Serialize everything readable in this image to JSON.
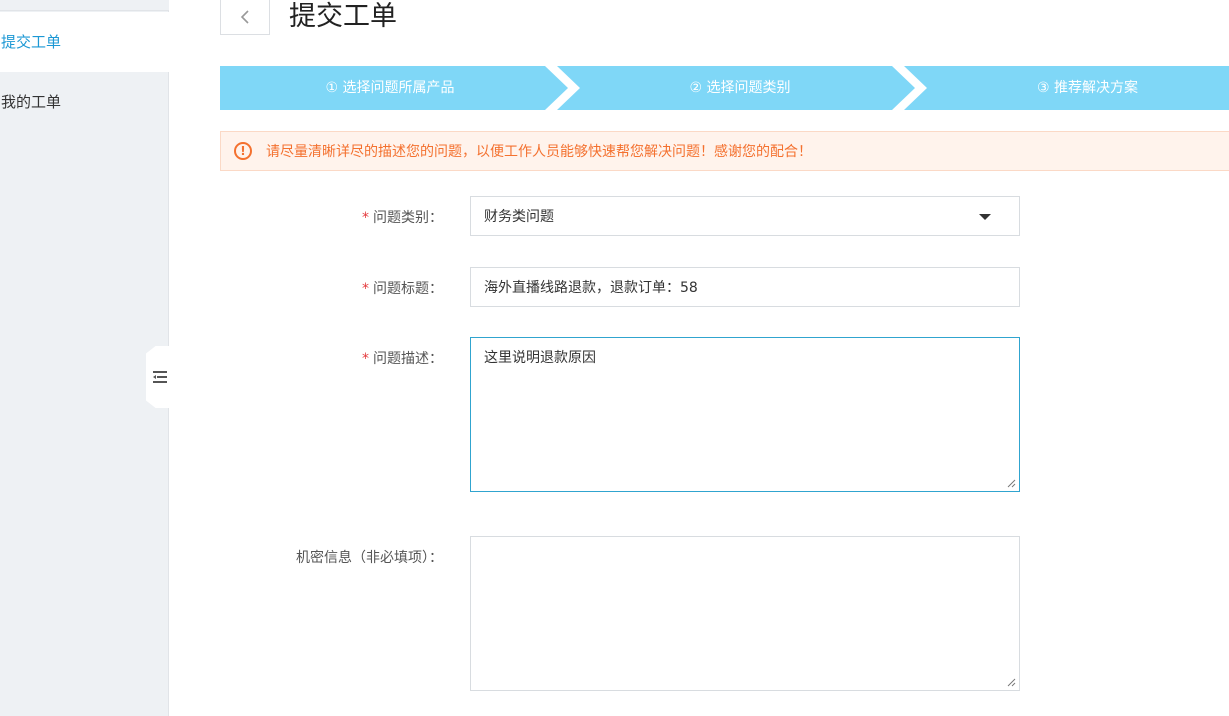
{
  "sidebar": {
    "items": [
      {
        "label": "提交工单",
        "active": true
      },
      {
        "label": "我的工单",
        "active": false
      }
    ]
  },
  "header": {
    "title": "提交工单"
  },
  "steps": [
    {
      "label": "① 选择问题所属产品"
    },
    {
      "label": "② 选择问题类别"
    },
    {
      "label": "③ 推荐解决方案"
    }
  ],
  "alert": {
    "icon": "exclamation-circle-icon",
    "text": "请尽量清晰详尽的描述您的问题，以便工作人员能够快速帮您解决问题！感谢您的配合！"
  },
  "form": {
    "category": {
      "label": "问题类别：",
      "value": "财务类问题"
    },
    "title": {
      "label": "问题标题：",
      "value": "海外直播线路退款，退款订单：58"
    },
    "description": {
      "label": "问题描述：",
      "value": "这里说明退款原因"
    },
    "secret": {
      "label": "机密信息（非必填项）：",
      "value": ""
    }
  },
  "colors": {
    "accent": "#1c98d4",
    "step_bg": "#7fd7f7",
    "alert_text": "#f4712f",
    "alert_bg": "#fff3ec",
    "required": "#e4393c"
  }
}
